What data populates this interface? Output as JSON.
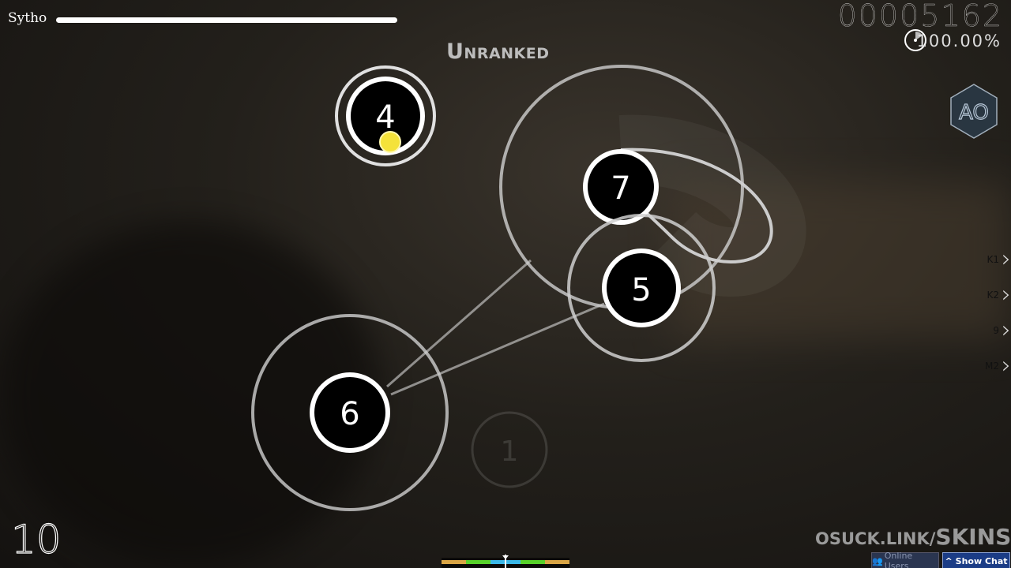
{
  "player": {
    "name": "Sytho",
    "health": 1.0
  },
  "status": "Unranked",
  "score": "00005162",
  "accuracy": "100.00%",
  "mod": "AO",
  "combo": "10",
  "keys": [
    {
      "label": "K1"
    },
    {
      "label": "K2"
    },
    {
      "label": "9"
    },
    {
      "label": "M2"
    }
  ],
  "hit_objects": [
    {
      "number": "4"
    },
    {
      "number": "7"
    },
    {
      "number": "5"
    },
    {
      "number": "6"
    },
    {
      "number": "1"
    }
  ],
  "watermark": {
    "prefix": "OSUCK.LINK/",
    "suffix": "SKINS"
  },
  "buttons": {
    "online_users": "Online Users",
    "show_chat": "Show Chat"
  },
  "colors": {
    "cursor": "#f4e23a",
    "ur_300": "#3bb8e8",
    "ur_100": "#57d12a",
    "ur_50": "#d9a545"
  }
}
